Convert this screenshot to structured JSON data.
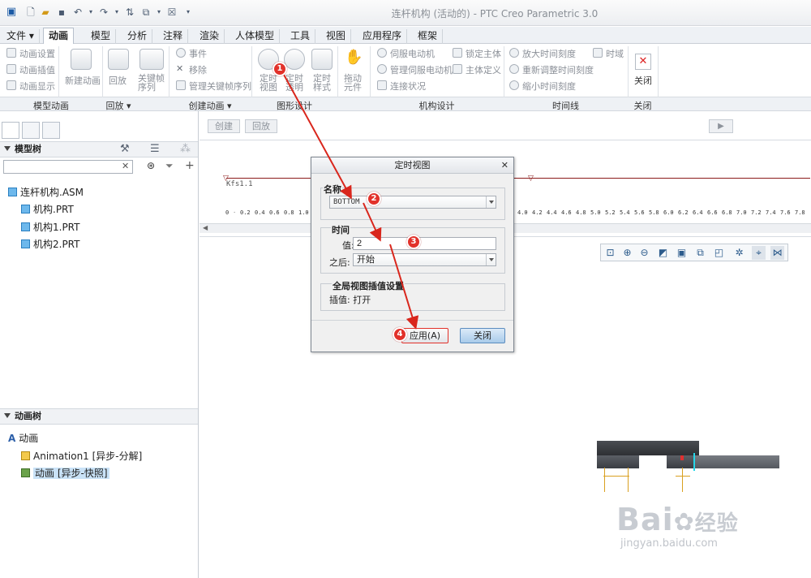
{
  "window": {
    "title": "连杆机构 (活动的) - PTC Creo Parametric 3.0"
  },
  "menu_tabs": [
    "文件",
    "动画",
    "模型",
    "分析",
    "注释",
    "渲染",
    "人体模型",
    "工具",
    "视图",
    "应用程序",
    "框架"
  ],
  "ribbon": {
    "model_animation": {
      "items": [
        "动画设置",
        "动画插值",
        "动画显示"
      ],
      "group": "模型动画"
    },
    "new_animation": "新建动画",
    "playback": {
      "button": "回放",
      "group": "回放"
    },
    "keyframe_seq": "关键帧序列",
    "create_animation": {
      "items": [
        "事件",
        "移除",
        "管理关键帧序列"
      ],
      "group": "创建动画"
    },
    "graphic_design": {
      "buttons": [
        "定时视图",
        "定时透明",
        "定时样式"
      ],
      "group": "图形设计"
    },
    "drag_element": "拖动元件",
    "mechanism": {
      "items": [
        "伺服电动机",
        "管理伺服电动机",
        "连接状况",
        "锁定主体",
        "主体定义"
      ],
      "group": "机构设计"
    },
    "timeline": {
      "items": [
        "放大时间刻度",
        "重新调整时间刻度",
        "缩小时间刻度",
        "时域"
      ],
      "group": "时间线"
    },
    "close": {
      "button": "关闭",
      "group": "关闭"
    }
  },
  "model_tree": {
    "header": "模型树",
    "search_placeholder": "",
    "items": [
      "连杆机构.ASM",
      "机构.PRT",
      "机构1.PRT",
      "机构2.PRT"
    ]
  },
  "animation_tree": {
    "header": "动画树",
    "items": [
      "动画",
      "Animation1 [异步-分解]",
      "动画 [异步-快照]"
    ]
  },
  "toolbar": {
    "create": "创建",
    "playback": "回放"
  },
  "timeline": {
    "keyframe_label": "Kfs1.1",
    "ticks": [
      "0",
      "0.2",
      "0.4",
      "0.6",
      "0.8",
      "1.0",
      "1.2",
      "1.4",
      "1.6",
      "1.8",
      "2.0",
      "2.2",
      "2.4",
      "2.6",
      "2.8",
      "3.0",
      "3.2",
      "3.4",
      "3.6",
      "3.8",
      "4.0",
      "4.2",
      "4.4",
      "4.6",
      "4.8",
      "5.0",
      "5.2",
      "5.4",
      "5.6",
      "5.8",
      "6.0",
      "6.2",
      "6.4",
      "6.6",
      "6.8",
      "7.0",
      "7.2",
      "7.4",
      "7.6",
      "7.8",
      "8.0"
    ]
  },
  "dialog": {
    "title": "定时视图",
    "name_label": "名称",
    "name_value": "BOTTOM",
    "time_label": "时间",
    "value_label": "值:",
    "value": "2",
    "after_label": "之后:",
    "after_value": "开始",
    "global_label": "全局视图插值设置",
    "interp_text": "插值: 打开",
    "apply": "应用(A)",
    "close": "关闭"
  },
  "annotations": [
    "1",
    "2",
    "3",
    "4"
  ],
  "watermark": {
    "brand": "Bai",
    "cn": "经验",
    "url": "jingyan.baidu.com"
  },
  "colors": {
    "badge": "#e2312a",
    "arrow": "#d9261c",
    "timeline_line": "#8b1a1a",
    "apply_border": "#e2312a"
  }
}
